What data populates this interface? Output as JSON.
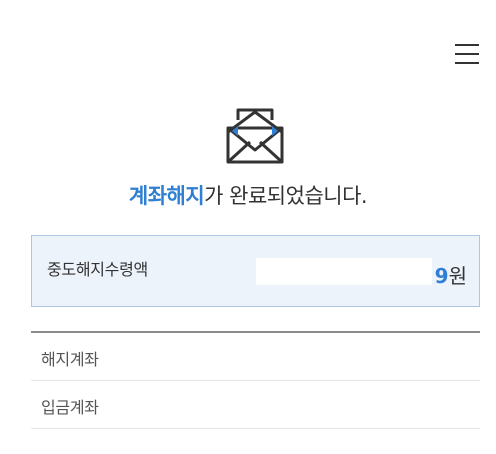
{
  "header": {
    "menu_icon": "hamburger-menu-icon"
  },
  "status": {
    "icon": "open-envelope-icon",
    "title_accent": "계좌해지",
    "title_rest": "가 완료되었습니다."
  },
  "amount": {
    "label": "중도해지수령액",
    "value_visible_digit": "9",
    "unit": "원"
  },
  "details": {
    "rows": [
      {
        "label": "해지계좌",
        "value_fragment": ""
      },
      {
        "label": "입금계좌",
        "value_fragment": ""
      }
    ]
  },
  "colors": {
    "accent": "#2f7fd3",
    "box_background": "#edf3fb",
    "box_border": "#aec5e6",
    "text": "#333333"
  }
}
